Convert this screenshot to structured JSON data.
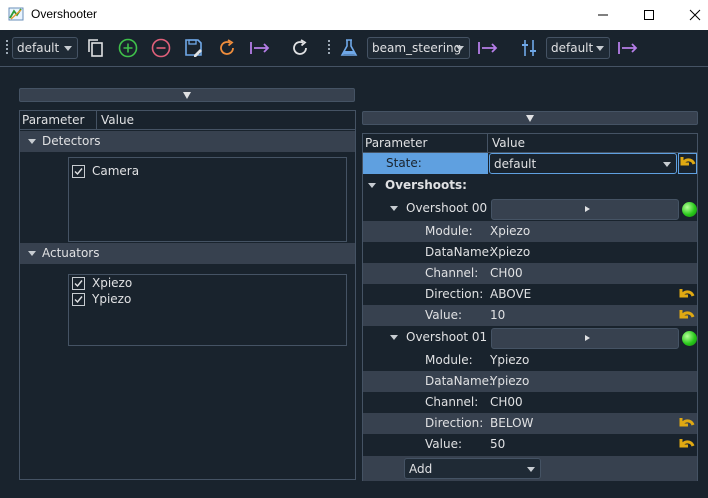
{
  "window": {
    "title": "Overshooter"
  },
  "toolbar": {
    "layout_combo": "default",
    "preset_combo": "beam_steering",
    "settings_combo": "default"
  },
  "left": {
    "header": {
      "param": "Parameter",
      "value": "Value"
    },
    "detectors": {
      "label": "Detectors",
      "items": [
        {
          "label": "Camera",
          "checked": true
        }
      ]
    },
    "actuators": {
      "label": "Actuators",
      "items": [
        {
          "label": "Xpiezo",
          "checked": true
        },
        {
          "label": "Ypiezo",
          "checked": true
        }
      ]
    }
  },
  "right": {
    "header": {
      "param": "Parameter",
      "value": "Value"
    },
    "state": {
      "label": "State:",
      "value": "default"
    },
    "overshoots": {
      "label": "Overshoots:",
      "groups": [
        {
          "label": "Overshoot 00",
          "module_label": "Module:",
          "module": "Xpiezo",
          "dataname_label": "DataName:",
          "dataname": "Xpiezo",
          "channel_label": "Channel:",
          "channel": "CH00",
          "direction_label": "Direction:",
          "direction": "ABOVE",
          "value_label": "Value:",
          "value": "10"
        },
        {
          "label": "Overshoot 01",
          "module_label": "Module:",
          "module": "Ypiezo",
          "dataname_label": "DataName:",
          "dataname": "Ypiezo",
          "channel_label": "Channel:",
          "channel": "CH00",
          "direction_label": "Direction:",
          "direction": "BELOW",
          "value_label": "Value:",
          "value": "50"
        }
      ]
    },
    "add_combo": "Add"
  },
  "colors": {
    "background": "#19232d",
    "alt_row": "#37414f",
    "border": "#455364",
    "selection": "#5fa0e0",
    "accent_green": "#3fc04a",
    "accent_red": "#e0607a",
    "accent_orange": "#ef8d3c",
    "accent_purple": "#b57de8"
  }
}
